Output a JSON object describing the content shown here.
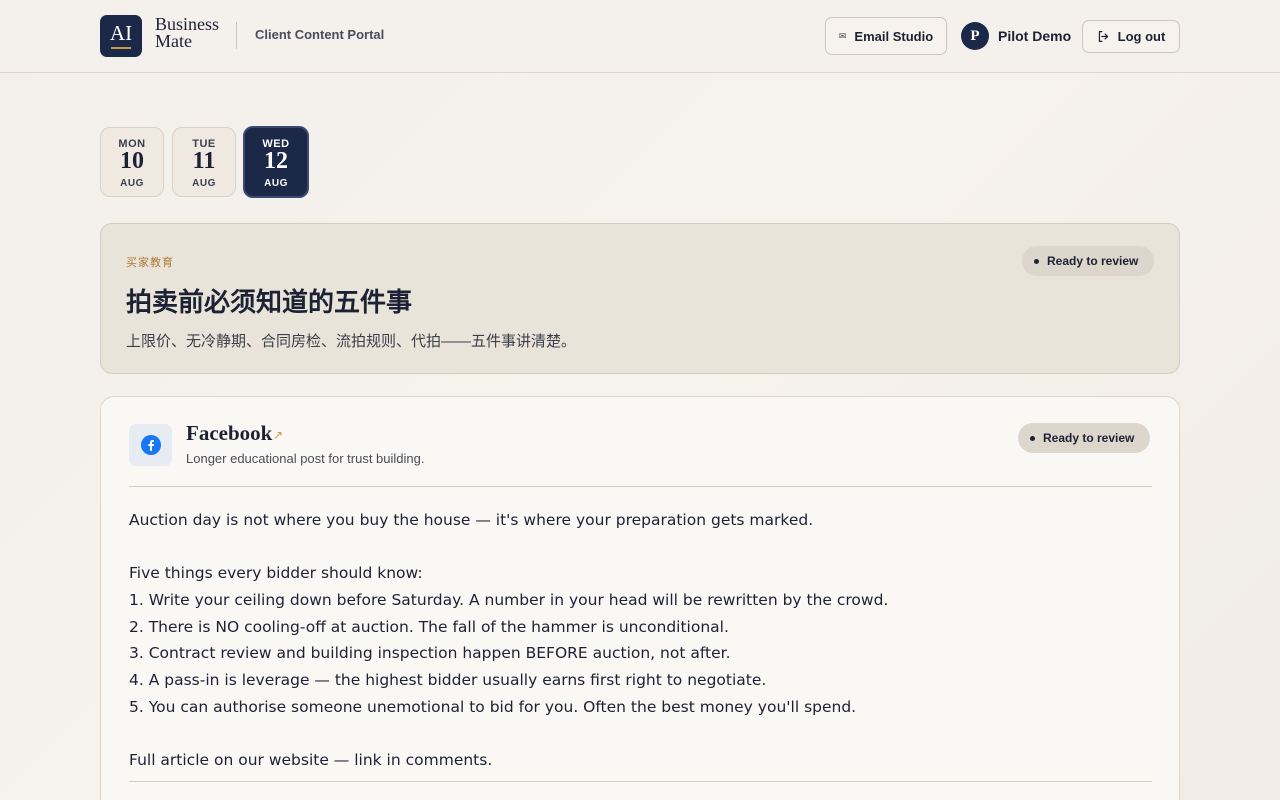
{
  "header": {
    "logo_mark": "AI",
    "brand_line1": "Business",
    "brand_line2": "Mate",
    "portal_label": "Client Content Portal",
    "email_studio_label": "Email Studio",
    "user_initial": "P",
    "user_name": "Pilot Demo",
    "logout_label": "Log out"
  },
  "days": [
    {
      "dow": "MON",
      "num": "10",
      "mon": "AUG",
      "active": false
    },
    {
      "dow": "TUE",
      "num": "11",
      "mon": "AUG",
      "active": false
    },
    {
      "dow": "WED",
      "num": "12",
      "mon": "AUG",
      "active": true
    }
  ],
  "summary": {
    "category": "买家教育",
    "title": "拍卖前必须知道的五件事",
    "subtitle": "上限价、无冷静期、合同房检、流拍规则、代拍——五件事讲清楚。",
    "status": "Ready to review"
  },
  "post": {
    "platform": "Facebook",
    "external_icon": "↗",
    "description": "Longer educational post for trust building.",
    "status": "Ready to review",
    "lines": [
      "Auction day is not where you buy the house — it's where your preparation gets marked.",
      "",
      "Five things every bidder should know:",
      "1. Write your ceiling down before Saturday. A number in your head will be rewritten by the crowd.",
      "2. There is NO cooling-off at auction. The fall of the hammer is unconditional.",
      "3. Contract review and building inspection happen BEFORE auction, not after.",
      "4. A pass-in is leverage — the highest bidder usually earns first right to negotiate.",
      "5. You can authorise someone unemotional to bid for you. Often the best money you'll spend.",
      "",
      "Full article on our website — link in comments."
    ]
  },
  "colors": {
    "navy": "#1b2847",
    "gold": "#c9974a",
    "facebook_blue": "#1877f2"
  },
  "icons": {
    "email": "envelope-icon",
    "logout": "logout-icon",
    "facebook": "facebook-icon",
    "external": "external-link-icon"
  }
}
